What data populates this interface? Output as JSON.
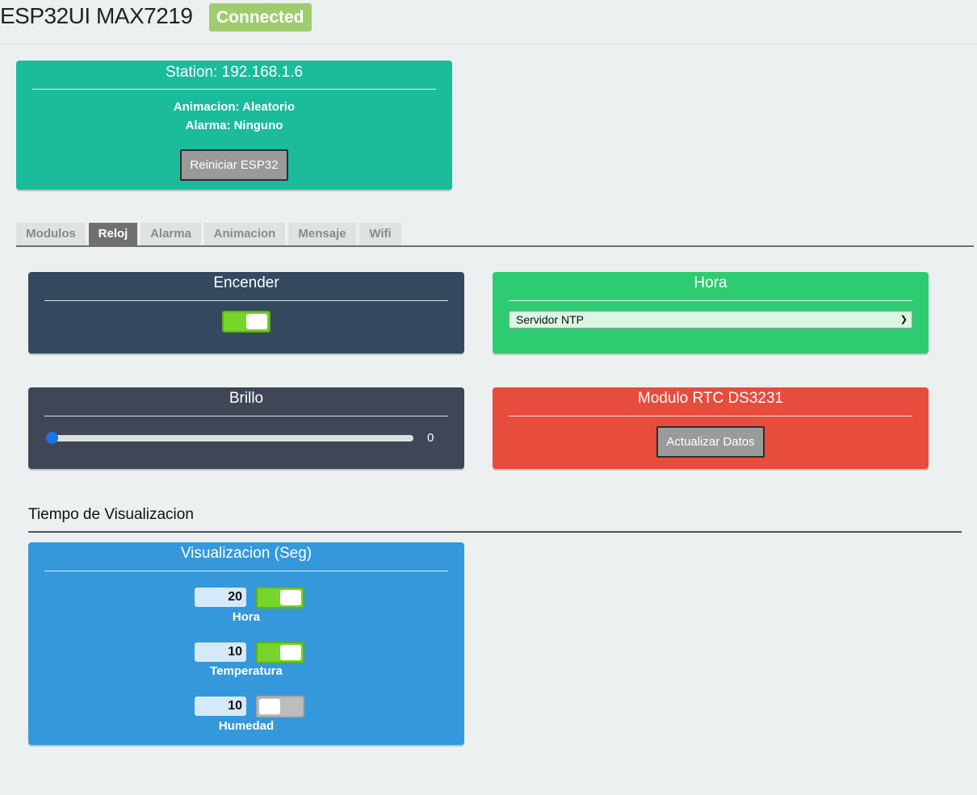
{
  "header": {
    "title": "ESP32UI MAX7219",
    "status": "Connected"
  },
  "station_card": {
    "title": "Station: 192.168.1.6",
    "animacion": "Animacion: Aleatorio",
    "alarma": "Alarma: Ninguno",
    "restart_button": "Reiniciar ESP32"
  },
  "tabs": [
    {
      "label": "Modulos"
    },
    {
      "label": "Reloj"
    },
    {
      "label": "Alarma"
    },
    {
      "label": "Animacion"
    },
    {
      "label": "Mensaje"
    },
    {
      "label": "Wifi"
    }
  ],
  "active_tab": "Reloj",
  "encender": {
    "title": "Encender",
    "toggle_on": true
  },
  "hora": {
    "title": "Hora",
    "selected": "Servidor NTP"
  },
  "brillo": {
    "title": "Brillo",
    "value": "0"
  },
  "rtc": {
    "title": "Modulo RTC DS3231",
    "button": "Actualizar Datos"
  },
  "section": {
    "heading": "Tiempo de Visualizacion"
  },
  "visualizacion": {
    "title": "Visualizacion (Seg)",
    "rows": [
      {
        "value": "20",
        "label": "Hora",
        "on": true
      },
      {
        "value": "10",
        "label": "Temperatura",
        "on": true
      },
      {
        "value": "10",
        "label": "Humedad",
        "on": false
      }
    ]
  },
  "colors": {
    "station": "#1abc9c",
    "encender": "#34495e",
    "hora": "#2ecc71",
    "brillo": "#3f4656",
    "rtc": "#e74c3c",
    "visualizacion": "#3498db",
    "badge": "#9fcd6e"
  }
}
